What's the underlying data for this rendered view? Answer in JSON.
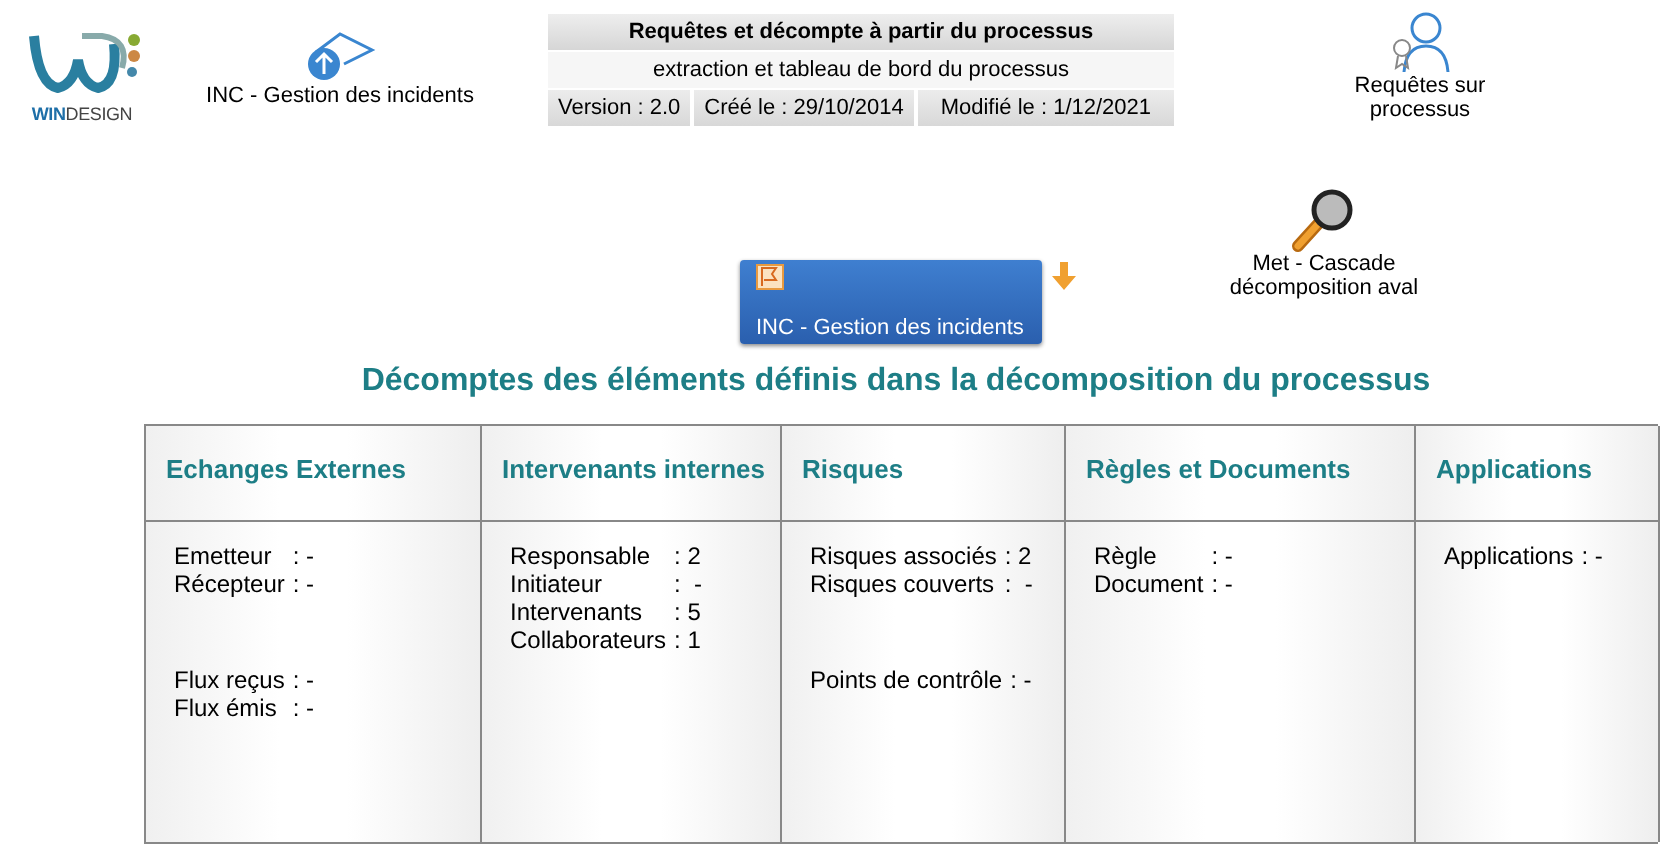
{
  "logo": {
    "text": "**WIN**DESIGN"
  },
  "process_link": {
    "label": "INC - Gestion des incidents"
  },
  "header": {
    "title": "Requêtes et décompte à partir du processus",
    "subtitle": "extraction et tableau de bord du processus",
    "meta": [
      "Version : 2.0",
      "Créé le : 29/10/2014",
      "Modifié le : 1/12/2021"
    ]
  },
  "queries_link": {
    "label": "Requêtes sur processus"
  },
  "process_button": {
    "label": "INC - Gestion des incidents"
  },
  "cascade_link": {
    "label": "Met -  Cascade décomposition aval"
  },
  "section_title": "Décomptes des éléments définis dans la décomposition du processus",
  "table": {
    "columns": [
      {
        "header": "Echanges Externes",
        "groups": [
          [
            {
              "label": "Emetteur",
              "value": ": -"
            },
            {
              "label": "Récepteur",
              "value": ": -"
            }
          ],
          [
            {
              "label": "Flux reçus",
              "value": ": -"
            },
            {
              "label": "Flux émis",
              "value": ": -"
            }
          ]
        ]
      },
      {
        "header": "Intervenants internes",
        "groups": [
          [
            {
              "label": "Responsable",
              "value": ": 2"
            },
            {
              "label": "Initiateur",
              "value": ":  -"
            },
            {
              "label": "Intervenants",
              "value": ": 5"
            },
            {
              "label": "Collaborateurs",
              "value": ": 1"
            }
          ]
        ]
      },
      {
        "header": "Risques",
        "groups": [
          [
            {
              "label": "Risques associés",
              "value": ": 2"
            },
            {
              "label": "Risques couverts",
              "value": ":  -"
            }
          ],
          [
            {
              "label": "Points de contrôle",
              "value": ": -"
            }
          ]
        ]
      },
      {
        "header": "Règles et Documents",
        "groups": [
          [
            {
              "label": "Règle",
              "value": ": -"
            },
            {
              "label": "Document",
              "value": ": -"
            }
          ]
        ]
      },
      {
        "header": "Applications",
        "groups": [
          [
            {
              "label": "Applications",
              "value": ": -"
            }
          ]
        ]
      }
    ]
  }
}
